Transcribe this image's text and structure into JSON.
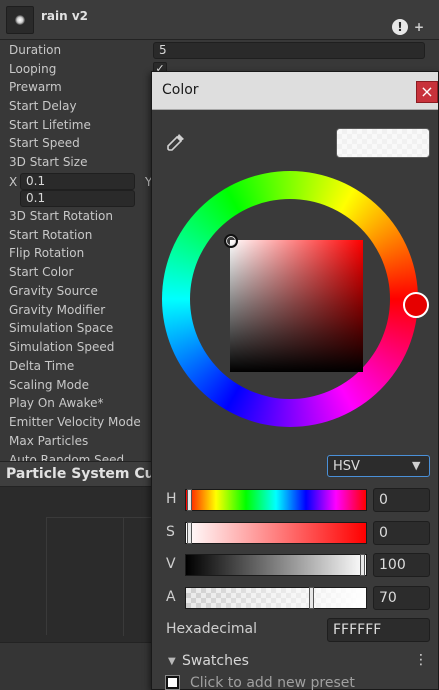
{
  "inspector": {
    "title": "rain v2",
    "duration": {
      "label": "Duration",
      "value": "5"
    },
    "looping": {
      "label": "Looping",
      "checked": "✓"
    },
    "labels": {
      "prewarm": "Prewarm",
      "start_delay": "Start Delay",
      "start_lifetime": "Start Lifetime",
      "start_speed": "Start Speed",
      "size_3d": "3D Start Size",
      "rotation_3d": "3D Start Rotation",
      "start_rotation": "Start Rotation",
      "flip_rotation": "Flip Rotation",
      "start_color": "Start Color",
      "gravity_source": "Gravity Source",
      "gravity_modifier": "Gravity Modifier",
      "simulation_space": "Simulation Space",
      "simulation_speed": "Simulation Speed",
      "delta_time": "Delta Time",
      "scaling_mode": "Scaling Mode",
      "play_on_awake": "Play On Awake*",
      "emitter_velocity_mode": "Emitter Velocity Mode",
      "max_particles": "Max Particles",
      "auto_random_seed": "Auto Random Seed"
    },
    "size_x": {
      "label": "X",
      "value": "0.1"
    },
    "size_y_label": "Y",
    "size_y_value": "0.1",
    "curves_title": "Particle System Curves"
  },
  "picker": {
    "title": "Color",
    "close": "×",
    "mode": "HSV",
    "mode_arrow": "▼",
    "h": {
      "label": "H",
      "value": "0",
      "fraction": 0.0
    },
    "s": {
      "label": "S",
      "value": "0",
      "fraction": 0.0
    },
    "v": {
      "label": "V",
      "value": "100",
      "fraction": 1.0
    },
    "a": {
      "label": "A",
      "value": "70",
      "fraction": 0.7
    },
    "hex_label": "Hexadecimal",
    "hex_value": "FFFFFF",
    "swatches_label": "Swatches",
    "swatches_toggle": "▼",
    "menu": "⋮",
    "preset_hint": "Click to add new preset",
    "hue_color": "#ff0000",
    "current_color": "#ffffff"
  }
}
